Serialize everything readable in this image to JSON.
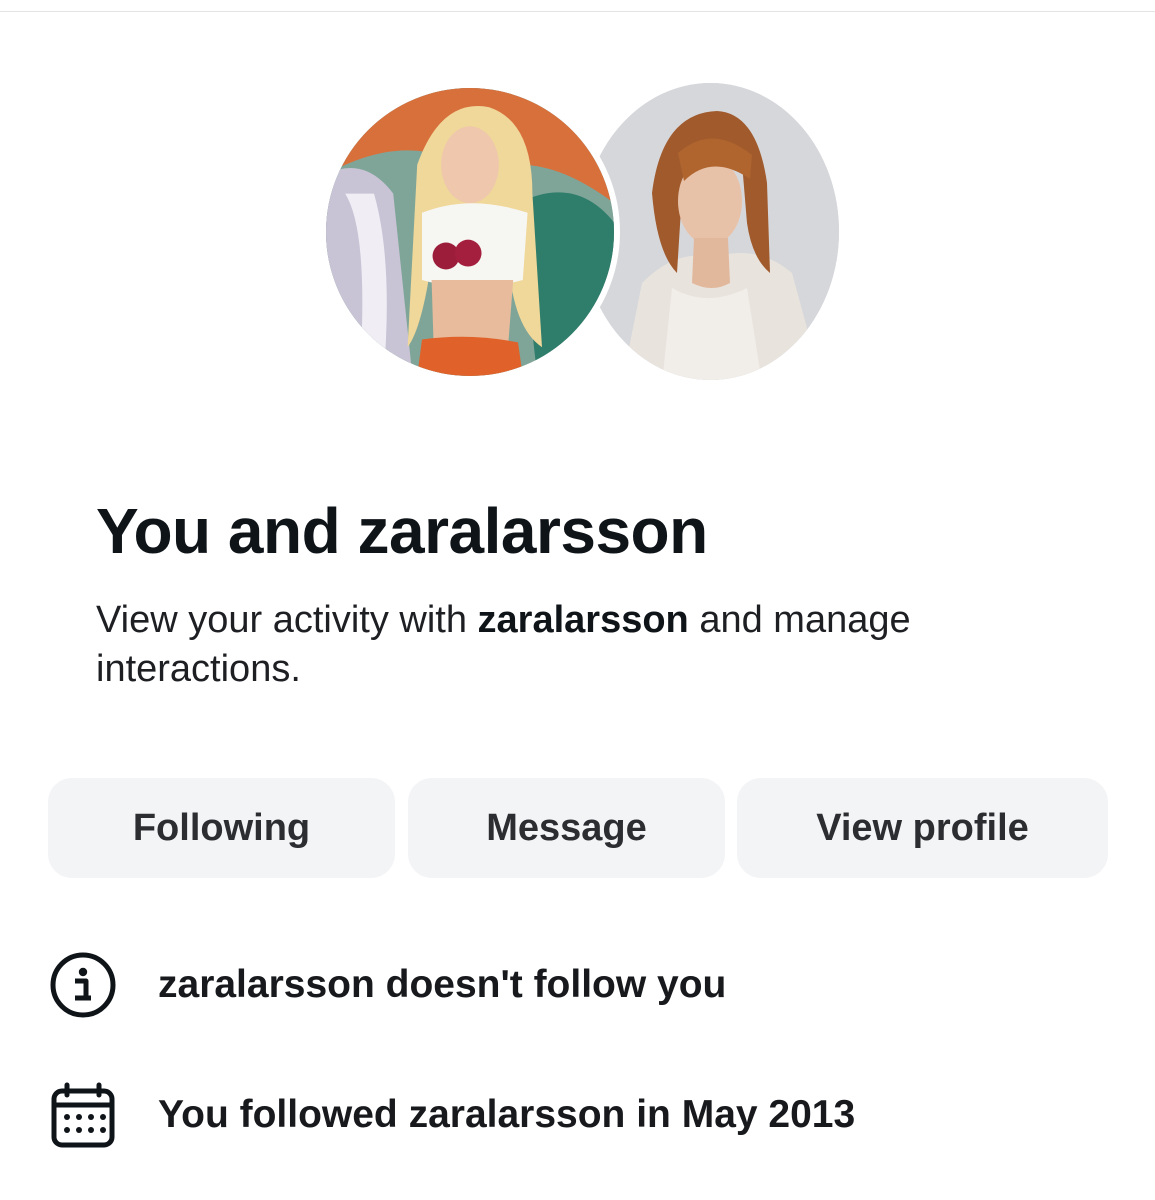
{
  "header": {
    "title": "You and zaralarsson",
    "subtitle": {
      "prefix": "View your activity with ",
      "username": "zaralarsson",
      "suffix": " and manage interactions."
    }
  },
  "avatars": {
    "left": "profile-photo-zaralarsson",
    "right": "profile-photo-you"
  },
  "actions": {
    "following_label": "Following",
    "message_label": "Message",
    "view_profile_label": "View profile"
  },
  "details": {
    "follow_status": "zaralarsson doesn't follow you",
    "followed_since": "You followed zaralarsson in May 2013",
    "follow_status_icon": "info-icon",
    "followed_since_icon": "calendar-icon"
  },
  "colors": {
    "button_bg": "#f3f4f6",
    "title_text": "#0f1419",
    "body_text": "#1d1f23"
  }
}
